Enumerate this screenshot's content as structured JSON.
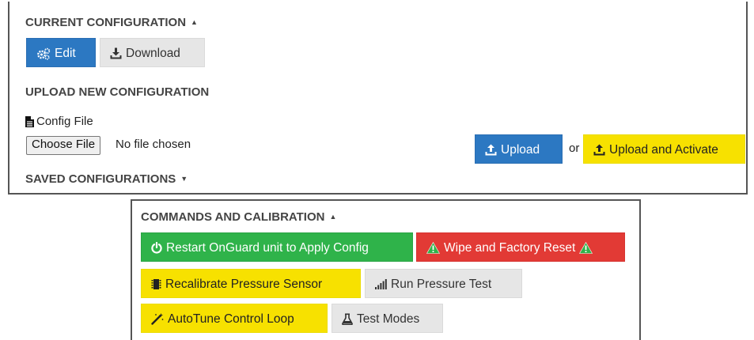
{
  "config": {
    "current_heading": "CURRENT CONFIGURATION",
    "edit_label": "Edit",
    "download_label": "Download",
    "upload_heading": "UPLOAD NEW CONFIGURATION",
    "file_label": "Config File",
    "choose_file_label": "Choose File",
    "no_file_text": "No file chosen",
    "upload_label": "Upload",
    "or_text": "or",
    "upload_activate_label": "Upload and Activate",
    "saved_heading": "SAVED CONFIGURATIONS"
  },
  "commands": {
    "heading": "COMMANDS AND CALIBRATION",
    "restart_label": "Restart OnGuard unit to Apply Config",
    "wipe_label": "Wipe and Factory Reset",
    "recalibrate_label": "Recalibrate Pressure Sensor",
    "pressure_test_label": "Run Pressure Test",
    "autotune_label": "AutoTune Control Loop",
    "test_modes_label": "Test Modes"
  },
  "icons": {
    "edit": "cogs-icon",
    "download": "download-icon",
    "file": "file-icon",
    "upload": "upload-icon",
    "restart": "power-icon",
    "warning": "warning-icon",
    "chip": "chip-icon",
    "signal": "signal-bars-icon",
    "wand": "magic-wand-icon",
    "flask": "flask-icon"
  },
  "colors": {
    "primary": "#2c78c2",
    "secondary": "#e6e6e6",
    "warning": "#f7e100",
    "success": "#2fb34a",
    "danger": "#e23a35"
  }
}
